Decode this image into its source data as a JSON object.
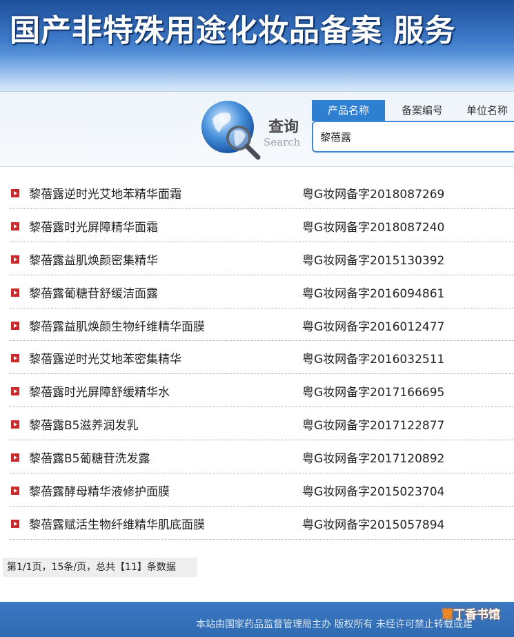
{
  "header": {
    "title": "国产非特殊用途化妆品备案 服务"
  },
  "search": {
    "label_cn": "查询",
    "label_en": "Search",
    "tabs": [
      "产品名称",
      "备案编号",
      "单位名称"
    ],
    "active_tab": "产品名称",
    "input_value": "黎蓓露"
  },
  "results": [
    {
      "name": "黎蓓露逆时光艾地苯精华面霜",
      "code": "粤G妆网备字2018087269"
    },
    {
      "name": "黎蓓露时光屏障精华面霜",
      "code": "粤G妆网备字2018087240"
    },
    {
      "name": "黎蓓露益肌焕颜密集精华",
      "code": "粤G妆网备字2015130392"
    },
    {
      "name": "黎蓓露葡糖苷舒缓洁面露",
      "code": "粤G妆网备字2016094861"
    },
    {
      "name": "黎蓓露益肌焕颜生物纤维精华面膜",
      "code": "粤G妆网备字2016012477"
    },
    {
      "name": "黎蓓露逆时光艾地苯密集精华",
      "code": "粤G妆网备字2016032511"
    },
    {
      "name": "黎蓓露时光屏障舒缓精华水",
      "code": "粤G妆网备字2017166695"
    },
    {
      "name": "黎蓓露B5滋养润发乳",
      "code": "粤G妆网备字2017122877"
    },
    {
      "name": "黎蓓露B5葡糖苷洗发露",
      "code": "粤G妆网备字2017120892"
    },
    {
      "name": "黎蓓露酵母精华液修护面膜",
      "code": "粤G妆网备字2015023704"
    },
    {
      "name": "黎蓓露赋活生物纤维精华肌底面膜",
      "code": "粤G妆网备字2015057894"
    }
  ],
  "pagination": {
    "text": "第1/1页，15条/页，总共【11】条数据"
  },
  "footer": {
    "text": "本站由国家药品监督管理局主办 版权所有 未经许可禁止转载或建"
  },
  "watermark": {
    "part1": "蕈",
    "part2": "丁香书馆"
  },
  "colors": {
    "banner": "#2f6bb2",
    "tab_active": "#2f7fd1",
    "bullet": "#cc2a2a",
    "footer": "#2f6bb2"
  }
}
